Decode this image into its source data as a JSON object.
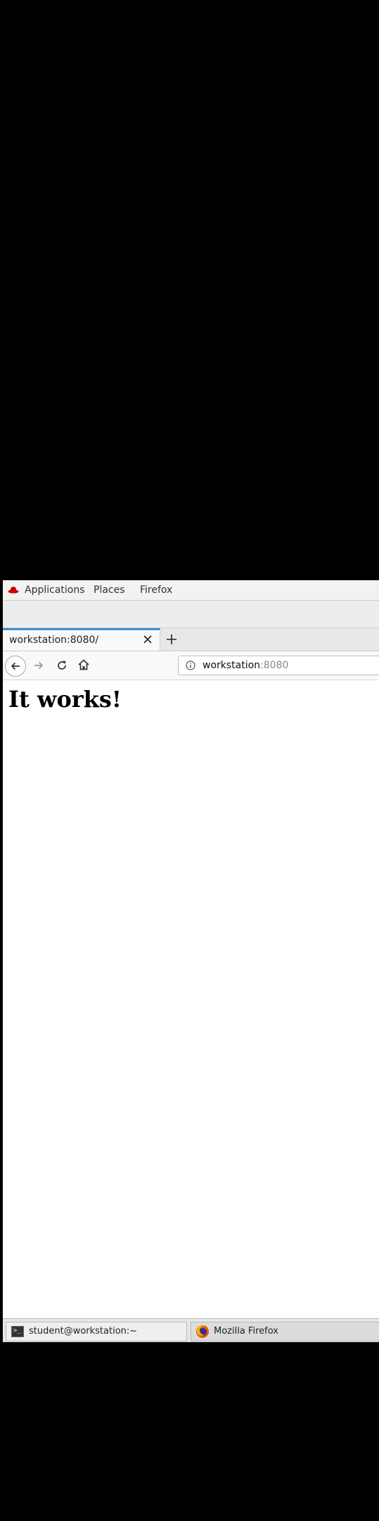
{
  "topbar": {
    "menus": [
      "Applications",
      "Places",
      "Firefox"
    ]
  },
  "browser": {
    "tab": {
      "title": "workstation:8080/"
    },
    "url": {
      "host": "workstation",
      "port": ":8080"
    }
  },
  "content": {
    "heading": "It works!"
  },
  "taskbar": {
    "items": [
      "student@workstation:~",
      "Mozilla Firefox"
    ]
  },
  "colors": {
    "accent_tab": "#3f8fd6",
    "redhat": "#cc0000"
  },
  "icons": {
    "redhat": "redhat-logo-icon",
    "back": "arrow-left-icon",
    "forward": "arrow-right-icon",
    "reload": "reload-icon",
    "home": "home-icon",
    "info": "info-icon",
    "close": "close-icon",
    "new_tab": "plus-icon",
    "terminal": "terminal-icon",
    "firefox": "firefox-icon"
  }
}
